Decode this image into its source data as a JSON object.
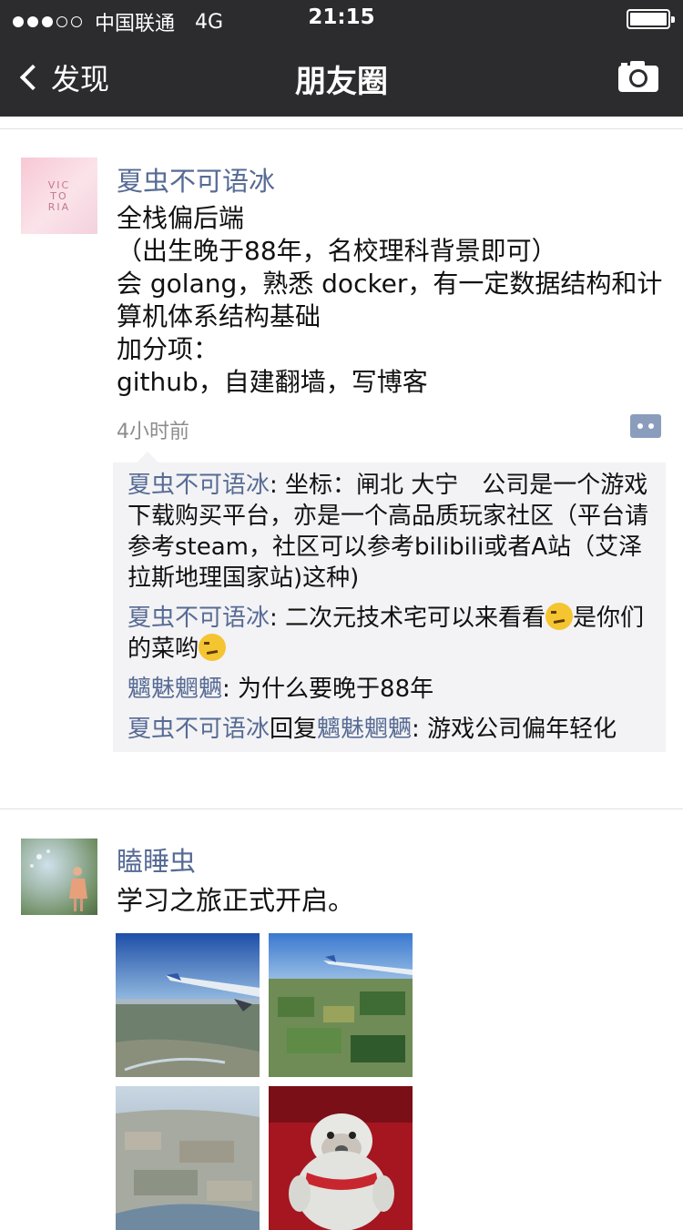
{
  "status_bar": {
    "carrier": "中国联通",
    "network": "4G",
    "time": "21:15"
  },
  "nav": {
    "back_label": "发现",
    "title": "朋友圈"
  },
  "post1": {
    "name": "夏虫不可语冰",
    "avatar_text": "VIC TO RIA",
    "text": "全栈偏后端\n（出生晚于88年，名校理科背景即可）\n会 golang，熟悉 docker，有一定数据结构和计算机体系结构基础\n加分项：\ngithub，自建翻墙，写博客",
    "time": "4小时前",
    "comments": [
      {
        "name": "夏虫不可语冰",
        "text": ": 坐标：闸北 大宁　公司是一个游戏下载购买平台，亦是一个高品质玩家社区（平台请参考steam，社区可以参考bilibili或者A站（艾泽拉斯地理国家站)这种)"
      },
      {
        "name": "夏虫不可语冰",
        "text": ": 二次元技术宅可以来看看",
        "text2": "是你们的菜哟"
      },
      {
        "name": "魑魅魍魉",
        "text": ": 为什么要晚于88年"
      },
      {
        "name": "夏虫不可语冰",
        "reply_word": "回复",
        "reply_to": "魑魅魍魉",
        "text": ": 游戏公司偏年轻化"
      }
    ]
  },
  "post2": {
    "name": "瞌睡虫",
    "text": "学习之旅正式开启。"
  },
  "colors": {
    "link": "#576b95",
    "bar": "#2c2c2e"
  },
  "icons": [
    "chevron-left-icon",
    "camera-icon",
    "comment-more-icon",
    "smirk-emoji-icon"
  ]
}
